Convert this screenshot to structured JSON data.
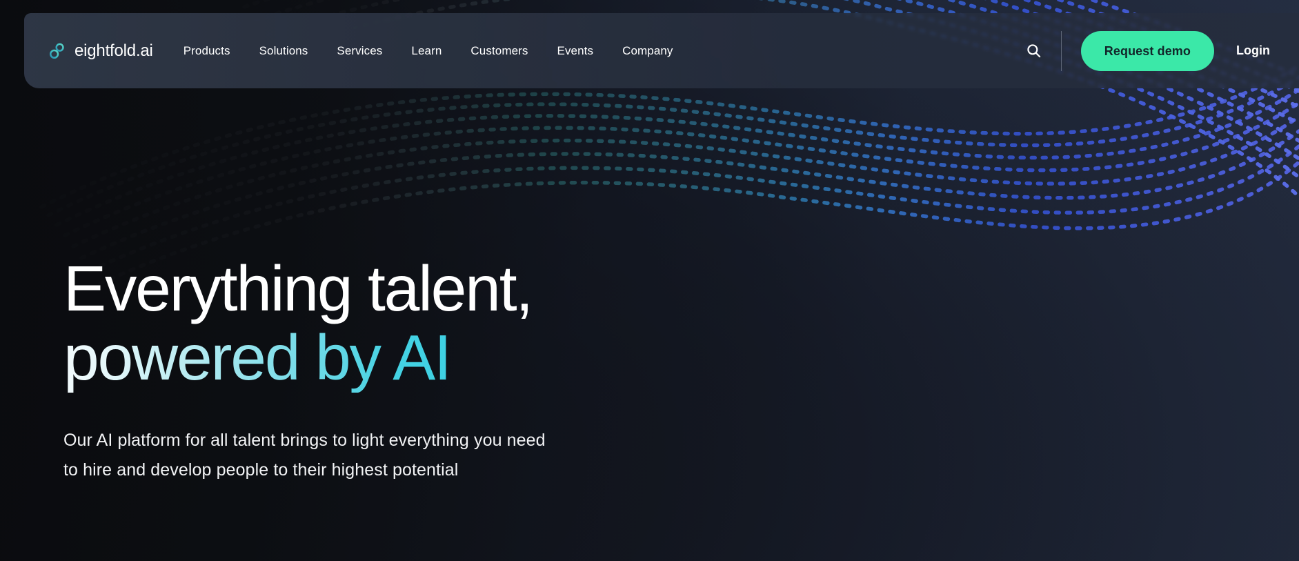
{
  "brand": {
    "name": "eightfold.ai",
    "logo_icon": "infinity-logo-icon",
    "logo_gradient_from": "#4FD1C5",
    "logo_gradient_to": "#2B9CB8"
  },
  "nav": {
    "items": [
      {
        "label": "Products"
      },
      {
        "label": "Solutions"
      },
      {
        "label": "Services"
      },
      {
        "label": "Learn"
      },
      {
        "label": "Customers"
      },
      {
        "label": "Events"
      },
      {
        "label": "Company"
      }
    ]
  },
  "header_actions": {
    "search_icon": "search-icon",
    "cta_label": "Request demo",
    "cta_bg": "#3BE8A8",
    "cta_text_color": "#12262A",
    "login_label": "Login"
  },
  "hero": {
    "headline_line1": "Everything talent,",
    "headline_line2": "powered by AI",
    "headline_line1_color": "#FFFFFF",
    "headline_line2_gradient_from": "#F4FBFD",
    "headline_line2_gradient_to": "#33CFE2",
    "subcopy_line1": "Our AI platform for all talent brings to light everything you need",
    "subcopy_line2": "to hire and develop people to their highest potential"
  },
  "theme": {
    "page_bg_dark": "#0E0F12",
    "page_bg_navy": "#252E42",
    "header_bg": "rgba(41,49,63,0.82)",
    "wave_cyan": "#3BD9E0",
    "wave_blue": "#3A5BF0",
    "wave_violet": "#5B6BF5"
  }
}
